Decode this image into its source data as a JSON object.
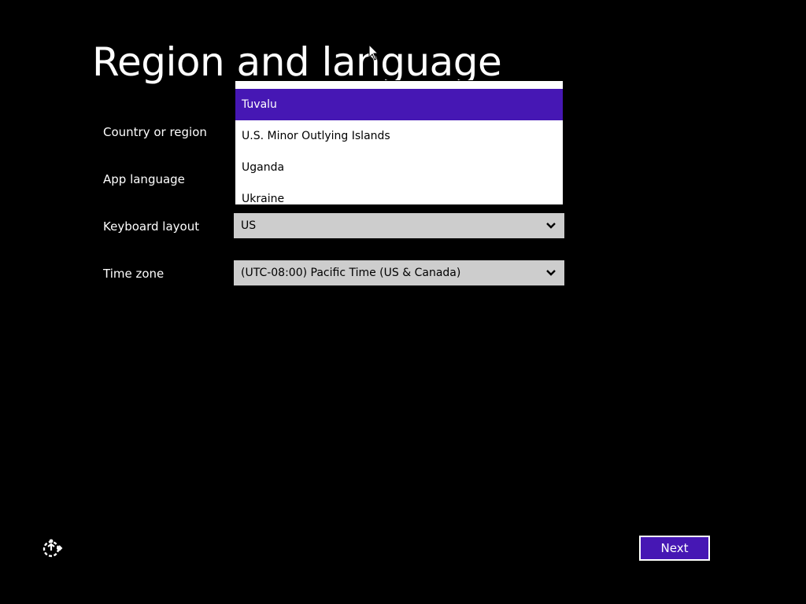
{
  "header": {
    "title": "Region and language"
  },
  "form": {
    "country_label": "Country or region",
    "app_language_label": "App language",
    "keyboard_label": "Keyboard layout",
    "keyboard_value": "US",
    "timezone_label": "Time zone",
    "timezone_value": "(UTC-08:00) Pacific Time (US & Canada)"
  },
  "country_dropdown": {
    "items": [
      {
        "label": "Tuvalu",
        "selected": true
      },
      {
        "label": "U.S. Minor Outlying Islands",
        "selected": false
      },
      {
        "label": "Uganda",
        "selected": false
      },
      {
        "label": "Ukraine",
        "selected": false
      }
    ]
  },
  "footer": {
    "next_label": "Next",
    "accessibility_icon": "ease-of-access-icon"
  },
  "colors": {
    "background": "#000000",
    "accent": "#4617b4",
    "select_bg": "#cdcdcd",
    "text": "#ffffff"
  }
}
